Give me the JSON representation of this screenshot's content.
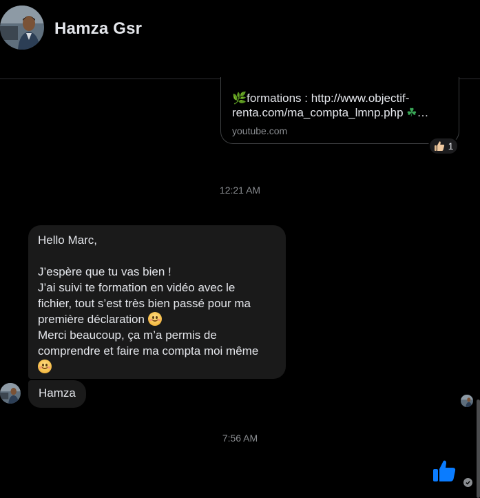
{
  "header": {
    "contact_name": "Hamza Gsr",
    "avatar_icon": "profile-photo"
  },
  "link_card": {
    "title_line1": "formations : http://www.objectif-",
    "title_line2": "renta.com/ma_compta_lmnp.php",
    "title_ellipsis": "…",
    "source": "youtube.com",
    "leaf_icon": "🌿",
    "clover_icon": "☘"
  },
  "reaction": {
    "emoji": "👍🏼",
    "count": "1"
  },
  "timestamps": {
    "first": "12:21 AM",
    "second": "7:56 AM"
  },
  "message": {
    "line1": "Hello Marc,",
    "line2": "J’espère que tu vas bien !",
    "line3": "J’ai suivi te formation en vidéo avec le",
    "line4": "fichier, tout s’est très bien passé pour ma",
    "line5": "première déclaration",
    "line6": "Merci beaucoup, ça m’a permis de",
    "line7": "comprendre et faire ma compta moi même",
    "signature": "Hamza"
  },
  "colors": {
    "background": "#000000",
    "bubble": "#1a1a1a",
    "text": "#e4e6eb",
    "muted": "#8a8d91",
    "like_blue": "#0a7cff"
  }
}
